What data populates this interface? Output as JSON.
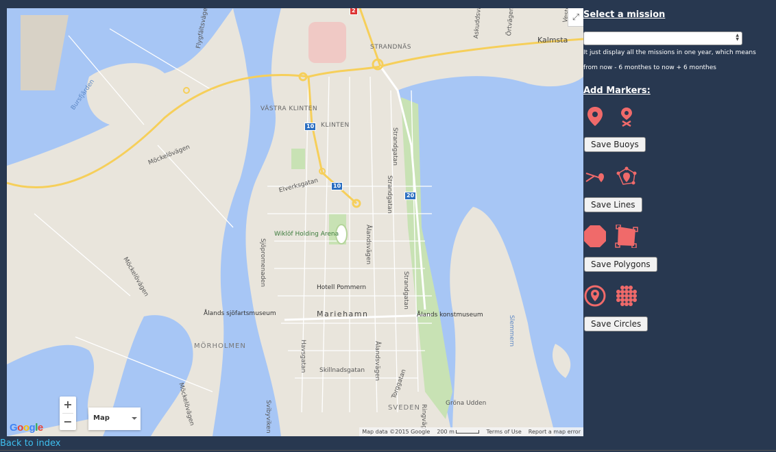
{
  "map": {
    "labels": {
      "strandnas": "STRANDNÄS",
      "vastra_klinten": "VÄSTRA KLINTEN",
      "klinten": "KLINTEN",
      "morholmen": "MÖRHOLMEN",
      "svedden": "SVEDEN",
      "mariehamn": "Mariehamn",
      "kalmsta": "Kalmsta",
      "bursfjarden": "Bursfjärden",
      "mockelovagen1": "Möckelövägen",
      "mockelovagen2": "Möckelövägen",
      "mockelovagen3": "Möckelövägen",
      "elverksgatan": "Elverksgatan",
      "strandgatan1": "Strandgatan",
      "strandgatan2": "Strandgatan",
      "strandgatan3": "Strandgatan",
      "alandsvagen1": "Ålandsvägen",
      "alandsvagen2": "Ålandsvägen",
      "sjopromenaden": "Sjöpromenaden",
      "havsgatan": "Havsgatan",
      "skillnadsgatan": "Skillnadsgatan",
      "torggatan": "Torggatan",
      "ringvag": "Ringväg",
      "sviby": "Svibyviken",
      "slemmern": "Slemmern",
      "flygfalt": "Flygfältsvägen",
      "wiklof": "Wiklöf Holding Arena",
      "hotell": "Hotell Pommern",
      "sjofart": "Ålands sjöfartsmuseum",
      "konstmuseum": "Ålands konstmuseum",
      "grona": "Gröna Udden",
      "askuddsv": "Askuddsvägen",
      "ortvagen": "Örtvägen",
      "vestra": "Vestra"
    },
    "shields": [
      "10",
      "10",
      "20",
      "2"
    ],
    "zoom_in": "+",
    "zoom_out": "−",
    "map_type": "Map",
    "google": [
      "G",
      "o",
      "o",
      "g",
      "l",
      "e"
    ],
    "google_colors": [
      "#4285f4",
      "#ea4335",
      "#fbbc05",
      "#4285f4",
      "#34a853",
      "#ea4335"
    ],
    "attribution": {
      "data": "Map data ©2015 Google",
      "scale": "200 m",
      "terms": "Terms of Use",
      "report": "Report a map error"
    }
  },
  "panel": {
    "select_title": "Select a mission",
    "note_line1": "It just display all the missions in one year, which means",
    "note_line2": "from now - 6 monthes to now + 6 monthes",
    "markers_title": "Add Markers:",
    "buttons": {
      "buoys": "Save Buoys",
      "lines": "Save Lines",
      "polygons": "Save Polygons",
      "circles": "Save Circles"
    },
    "icons": {
      "buoys": [
        "map-pin-icon",
        "pin-delete-icon"
      ],
      "lines": [
        "draw-line-icon",
        "edit-line-icon"
      ],
      "polygons": [
        "octagon-icon",
        "edit-polygon-icon"
      ],
      "circles": [
        "circle-pin-icon",
        "dot-grid-icon"
      ]
    },
    "accent_color": "#f06a6a"
  },
  "footer": {
    "back_link": "Back to index"
  }
}
